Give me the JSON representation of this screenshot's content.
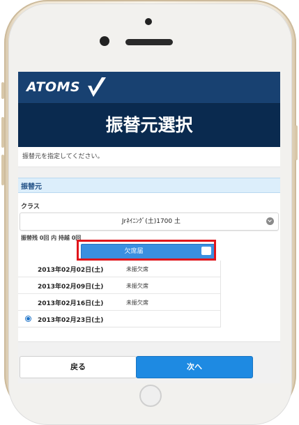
{
  "brand": {
    "name": "ATOMS"
  },
  "header": {
    "title": "振替元選択"
  },
  "instruction": "振替元を指定してください。",
  "section": {
    "title": "振替元"
  },
  "class_field": {
    "label": "クラス",
    "selected": "Jrﾈｲﾆﾝｸﾞ(土)1700 土"
  },
  "counts": "振替残 0回 内 持越 0回",
  "absence_button": {
    "label": "欠席届"
  },
  "dates": [
    {
      "date": "2013年02月02日(土)",
      "status": "未振欠席",
      "selected": false
    },
    {
      "date": "2013年02月09日(土)",
      "status": "未振欠席",
      "selected": false
    },
    {
      "date": "2013年02月16日(土)",
      "status": "未振欠席",
      "selected": false
    },
    {
      "date": "2013年02月23日(土)",
      "status": "",
      "selected": true
    }
  ],
  "buttons": {
    "back": "戻る",
    "next": "次へ"
  },
  "colors": {
    "brand_bar": "#184171",
    "title_bar": "#0a2a4f",
    "accent": "#1e8ae2",
    "highlight": "#e0151b"
  }
}
